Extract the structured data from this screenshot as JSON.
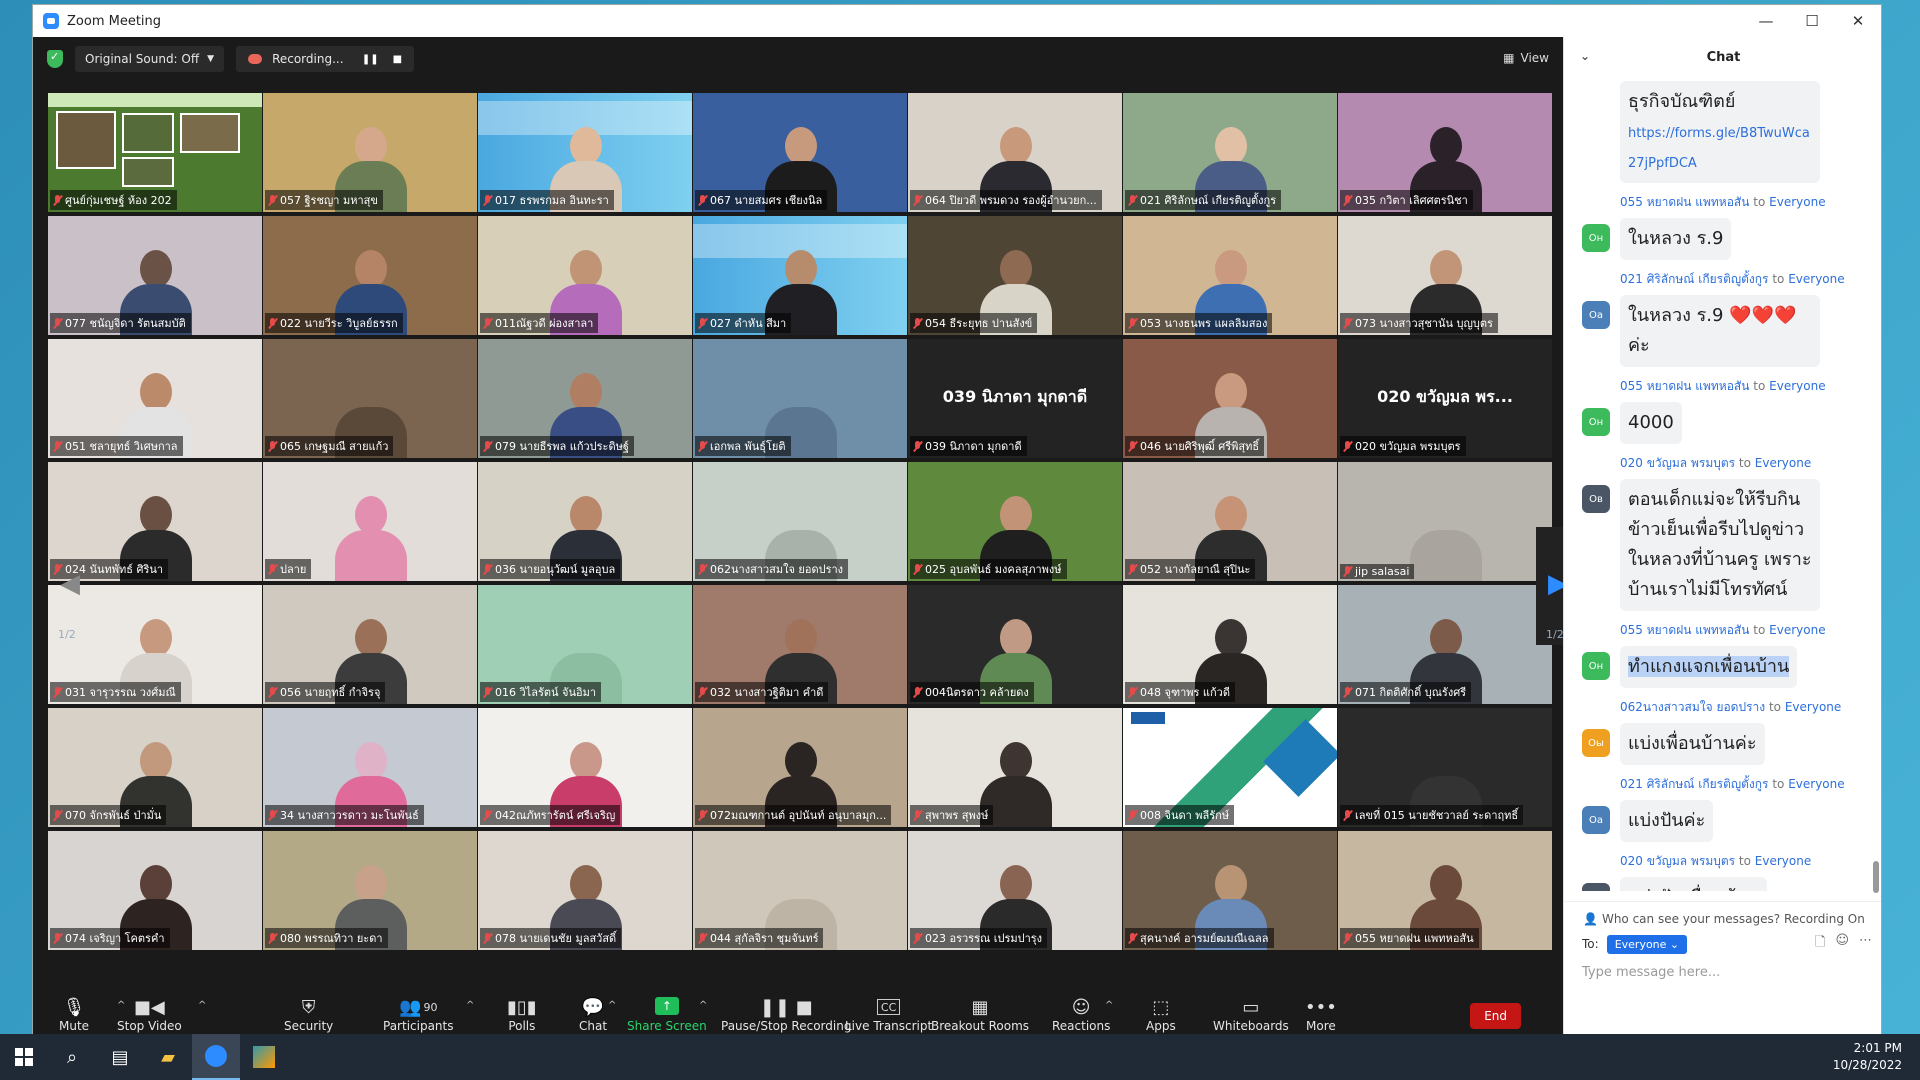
{
  "window": {
    "title": "Zoom Meeting"
  },
  "topbar": {
    "sound_label": "Original Sound: Off",
    "recording_label": "Recording...",
    "view_label": "View"
  },
  "tiles": [
    {
      "name": "ศูนย์กุ่มเชษฐ์ ห้อง 202",
      "kind": "slide",
      "active": true
    },
    {
      "name": "057 ฐิรชญา มหาสุข",
      "bg": "#c6a86a",
      "skin": "#d6a88b",
      "cloth": "#6a7d55"
    },
    {
      "name": "017 ธรพรกมล อินทะรา",
      "kind": "banner",
      "skin": "#e0b89a",
      "cloth": "#d9c8b6"
    },
    {
      "name": "067 นายสมศร เชียงนิล",
      "bg": "#3a5f9f",
      "skin": "#c79a7e",
      "cloth": "#1c1c1c"
    },
    {
      "name": "064 ปิยวดี พรมดวง รองผู้อำนวยก...",
      "bg": "#d8d2c8",
      "skin": "#c9997c",
      "cloth": "#2a2a30"
    },
    {
      "name": "021 ศิริลักษณ์ เกียรติญูตั้งกูร",
      "bg": "#8ea98a",
      "skin": "#e2c0a6",
      "cloth": "#4a5d86"
    },
    {
      "name": "035 กวิตา เลิศศตรนิชา",
      "bg": "#b58ab0",
      "skin": "#2a2228",
      "cloth": "#2a2228"
    },
    {
      "name": "077 ชนัญจิดา รัตนสมบัติ",
      "bg": "#c9c0c8",
      "skin": "#6b5246",
      "cloth": "#3a4c70"
    },
    {
      "name": "022 นายวีระ วิบูลย์ธรรก",
      "bg": "#8d6c4c",
      "skin": "#b58466",
      "cloth": "#2d4a7a"
    },
    {
      "name": "011ณัฐวดี ผ่องสาลา",
      "bg": "#d8cfb9",
      "skin": "#c09474",
      "cloth": "#b56dbb"
    },
    {
      "name": "027 ดำหัน สีมา",
      "kind": "banner",
      "skin": "#b78c6d",
      "cloth": "#1f1f24"
    },
    {
      "name": "054 ธีระยุทธ ปานสังข์",
      "bg": "#4e4535",
      "skin": "#8f6a52",
      "cloth": "#d9d4c8"
    },
    {
      "name": "053 นางธนพร แผลลิมสอง",
      "bg": "#d0b693",
      "skin": "#c99a80",
      "cloth": "#3e6fb3"
    },
    {
      "name": "073 นางสาวสุชานัน บุญบุตร",
      "bg": "#ddd8d0",
      "skin": "#c29478",
      "cloth": "#2b2b2b"
    },
    {
      "name": "051 ชลายุทธ์ วิเศษกาล",
      "bg": "#e6e1dc",
      "skin": "#bb8a6a",
      "cloth": "#e3e3e3"
    },
    {
      "name": "065 เกษฐมณี สายแก้ว",
      "bg": "#7b6450",
      "skin": "#7b6450",
      "cloth": "#5a4838"
    },
    {
      "name": "079 นายธีรพล แก้วประดิษฐ์",
      "bg": "#8e9a93",
      "skin": "#b07f63",
      "cloth": "#3a4e86"
    },
    {
      "name": "เอกพล พันธุ์โยติ",
      "bg": "#6f8fa8",
      "skin": "#6f8fa8",
      "cloth": "#5b7691"
    },
    {
      "name": "039 นิภาดา มุกดาดี",
      "kind": "name",
      "big": "039 นิภาดา มุกดาดี"
    },
    {
      "name": "046 นายศิริพุฒิ์ ศรีพิสุทธิ์",
      "bg": "#8a5a48",
      "skin": "#c99a80",
      "cloth": "#b8b3ae"
    },
    {
      "name": "020 ขวัญมล พรมบุตร",
      "kind": "name",
      "big": "020 ขวัญมล พร..."
    },
    {
      "name": "024 นันทพัทธ์ ศิรินา",
      "bg": "#ddd6cf",
      "skin": "#6a5043",
      "cloth": "#2b2b2b"
    },
    {
      "name": "ปลาย",
      "bg": "#e2ddd8",
      "skin": "#e38fb0",
      "cloth": "#e38fb0"
    },
    {
      "name": "036 นายอนุวัฒน์ มูลอุบล",
      "bg": "#d7d2c6",
      "skin": "#b9886a",
      "cloth": "#2a2f38"
    },
    {
      "name": "062นางสาวสมใจ ยอดปราง",
      "bg": "#c7cfc9",
      "skin": "#c7cfc9",
      "cloth": "#a8b2ab"
    },
    {
      "name": "025 อุบลพันธ์ มงคลสุภาพงษ์",
      "bg": "#5f8a3e",
      "skin": "#c39377",
      "cloth": "#1f1f1f"
    },
    {
      "name": "052 นางกัลยาณี สุปินะ",
      "bg": "#c8c0b6",
      "skin": "#c69377",
      "cloth": "#2d2d2d"
    },
    {
      "name": "jip salasai",
      "bg": "#b8b4ae",
      "skin": "#b8b4ae",
      "cloth": "#a9a49e"
    },
    {
      "name": "031 จารุวรรณ วงศ์มณี",
      "bg": "#ece8e4",
      "skin": "#c79a80",
      "cloth": "#d7d2cc"
    },
    {
      "name": "056 นายฤทธิ์ กำจิรจุ",
      "bg": "#cfc9c0",
      "skin": "#9a7058",
      "cloth": "#3c3c3c"
    },
    {
      "name": "016 วิไลรัตน์ จันอิมา",
      "bg": "#9fcfb4",
      "skin": "#9fcfb4",
      "cloth": "#8cbfa2"
    },
    {
      "name": "032 นางสาวฐิติมา คำดี",
      "bg": "#a07a6a",
      "skin": "#a0725a",
      "cloth": "#2f2f2f"
    },
    {
      "name": "004นิตรดาว คล้ายดง",
      "bg": "#2a2a2a",
      "skin": "#c09a84",
      "cloth": "#5f8a53"
    },
    {
      "name": "048 จุฑาพร แก้วดี",
      "bg": "#e6e2dc",
      "skin": "#3a3532",
      "cloth": "#2a2624"
    },
    {
      "name": "071 กิตติศักดิ์ บุณรังศรี",
      "bg": "#a7b1b6",
      "skin": "#7d5b4a",
      "cloth": "#32353c"
    },
    {
      "name": "070 จักรพันธ์ ป่ามั่น",
      "bg": "#d8d1c8",
      "skin": "#c3997d",
      "cloth": "#32322f"
    },
    {
      "name": "34 นางสาววรดาว มะโนพันธ์",
      "bg": "#c5c9d2",
      "skin": "#e0b2c8",
      "cloth": "#e06a99"
    },
    {
      "name": "042ณภัทรารัตน์ ศรีเจริญ",
      "bg": "#f2f0ed",
      "skin": "#c9988a",
      "cloth": "#c93d6a"
    },
    {
      "name": "072มณฑกานต์ อุปนันท์ อนุบาลมุก...",
      "bg": "#b7a58d",
      "skin": "#2a2522",
      "cloth": "#2a2522"
    },
    {
      "name": "สุพาพร สุพงษ์",
      "bg": "#e6e2dc",
      "skin": "#3e3431",
      "cloth": "#2f2a28"
    },
    {
      "name": "008 จินดา พลีรักษ์",
      "kind": "lps"
    },
    {
      "name": "เลขที่ 015 นายชัชวาลย์ ระดาฤทธิ์",
      "bg": "#2a2a2a",
      "skin": "#2a2a2a",
      "cloth": "#333"
    },
    {
      "name": "074 เจริญา โคตรคำ",
      "bg": "#d8d4d1",
      "skin": "#5a4038",
      "cloth": "#2d2320"
    },
    {
      "name": "080 พรรณทิวา ยะดา",
      "bg": "#b3a987",
      "skin": "#c7a18a",
      "cloth": "#5d5f5e"
    },
    {
      "name": "078 นายเดนชัย มูลสวัสดิ์",
      "bg": "#ddd7cf",
      "skin": "#8a6650",
      "cloth": "#4a4a55"
    },
    {
      "name": "044 สุกัลจิรา ชุมจันทร์",
      "bg": "#cfc7b9",
      "skin": "#cfc7b9",
      "cloth": "#bdb4a6"
    },
    {
      "name": "023 อรวรรณ เปรมปารุง",
      "bg": "#dcd8d3",
      "skin": "#8a6452",
      "cloth": "#2a2a2a"
    },
    {
      "name": "สุคนางค์ อารมย์ฒมณีเฉลล",
      "bg": "#6f5d4c",
      "skin": "#b89474",
      "cloth": "#6a8ab8"
    },
    {
      "name": "055 หยาดฝน แพทหอสัน",
      "bg": "#c6b7a1",
      "skin": "#6b4a3c",
      "cloth": "#6b4a3c"
    }
  ],
  "pager": {
    "left_label": "1/2",
    "right_label": "1/2"
  },
  "toolbar": {
    "mute": "Mute",
    "stop_video": "Stop Video",
    "security": "Security",
    "participants": "Participants",
    "participants_count": "90",
    "polls": "Polls",
    "chat": "Chat",
    "share_screen": "Share Screen",
    "pause_recording": "Pause/Stop Recording",
    "live_transcript": "Live Transcript",
    "breakout_rooms": "Breakout Rooms",
    "reactions": "Reactions",
    "apps": "Apps",
    "whiteboards": "Whiteboards",
    "more": "More",
    "end": "End"
  },
  "chat": {
    "title": "Chat",
    "top_bubble_text": "ธุรกิจบัณฑิตย์",
    "top_bubble_link": "https://forms.gle/B8TwuWca27jPpfDCA",
    "messages": [
      {
        "sender": "055 หยาดฝน แพทหอสัน",
        "to": "to",
        "target": "Everyone",
        "avatar": "Oн",
        "avatar_color": "#3dbb5c",
        "text": "ในหลวง ร.9"
      },
      {
        "sender": "021 ศิริลักษณ์ เกียรติญูตั้งกูร",
        "to": "to",
        "target": "Everyone",
        "avatar": "Oа",
        "avatar_color": "#4a7fb8",
        "text": "ในหลวง ร.9 ❤️❤️❤️ ค่ะ"
      },
      {
        "sender": "055 หยาดฝน แพทหอสัน",
        "to": "to",
        "target": "Everyone",
        "avatar": "Oн",
        "avatar_color": "#3dbb5c",
        "text": "4000"
      },
      {
        "sender": "020 ขวัญมล พรมบุตร",
        "to": "to",
        "target": "Everyone",
        "avatar": "Oв",
        "avatar_color": "#4a5566",
        "text": "ตอนเด็กแม่จะให้รีบกินข้าวเย็นเพื่อรีบไปดูข่าวในหลวงที่บ้านครู เพราะบ้านเราไม่มีโทรทัศน์"
      },
      {
        "sender": "055 หยาดฝน แพทหอสัน",
        "to": "to",
        "target": "Everyone",
        "avatar": "Oн",
        "avatar_color": "#3dbb5c",
        "text": "ทำแกงแจกเพื่อนบ้าน",
        "highlight": true
      },
      {
        "sender": "062นางสาวสมใจ ยอดปราง",
        "to": "to",
        "target": "Everyone",
        "avatar": "Oы",
        "avatar_color": "#f0a020",
        "text": "แบ่งเพื่อนบ้านค่ะ"
      },
      {
        "sender": "021 ศิริลักษณ์ เกียรติญูตั้งกูร",
        "to": "to",
        "target": "Everyone",
        "avatar": "Oа",
        "avatar_color": "#4a7fb8",
        "text": "แบ่งปันค่ะ"
      },
      {
        "sender": "020 ขวัญมล พรมบุตร",
        "to": "to",
        "target": "Everyone",
        "avatar": "Oв",
        "avatar_color": "#4a5566",
        "text": "แบ่งปันเพื่อนบ้าน"
      }
    ],
    "who_can_see": "Who can see your messages? Recording On",
    "to_label": "To:",
    "to_value": "Everyone",
    "placeholder": "Type message here..."
  },
  "taskbar": {
    "time": "2:01 PM",
    "date": "10/28/2022"
  }
}
